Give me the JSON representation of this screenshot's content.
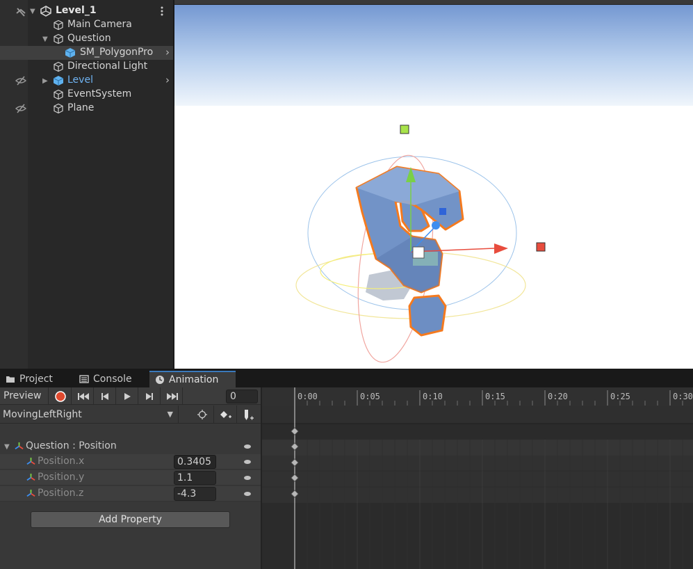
{
  "hierarchy": {
    "scene_name": "Level_1",
    "items": [
      {
        "label": "Main Camera",
        "icon": "gameobject-icon"
      },
      {
        "label": "Question",
        "icon": "gameobject-icon",
        "expanded": true
      },
      {
        "label": "SM_PolygonPro",
        "icon": "prefab-icon",
        "selected": true
      },
      {
        "label": "Directional Light",
        "icon": "gameobject-icon"
      },
      {
        "label": "Level",
        "icon": "prefab-icon",
        "hidden": true,
        "color": "#6fb3f2"
      },
      {
        "label": "EventSystem",
        "icon": "gameobject-icon"
      },
      {
        "label": "Plane",
        "icon": "gameobject-icon",
        "hidden": true
      }
    ]
  },
  "bottom_tabs": {
    "project": "Project",
    "console": "Console",
    "animation": "Animation"
  },
  "animation": {
    "preview_label": "Preview",
    "record_color": "#e04a2f",
    "current_frame": "0",
    "clip_name": "MovingLeftRight",
    "property_group": "Question : Position",
    "properties": [
      {
        "name": "Position.x",
        "value": "0.3405"
      },
      {
        "name": "Position.y",
        "value": "1.1"
      },
      {
        "name": "Position.z",
        "value": "-4.3"
      }
    ],
    "add_property_label": "Add Property",
    "timeline_labels": [
      "0:00",
      "0:05",
      "0:10",
      "0:15",
      "0:20",
      "0:25",
      "0:30"
    ]
  },
  "colors": {
    "accent": "#3a79bb",
    "selection_outline": "#f47a1f",
    "gizmo_x": "#e84c3d",
    "gizmo_y": "#7ad047",
    "gizmo_z": "#3d8ef0"
  }
}
